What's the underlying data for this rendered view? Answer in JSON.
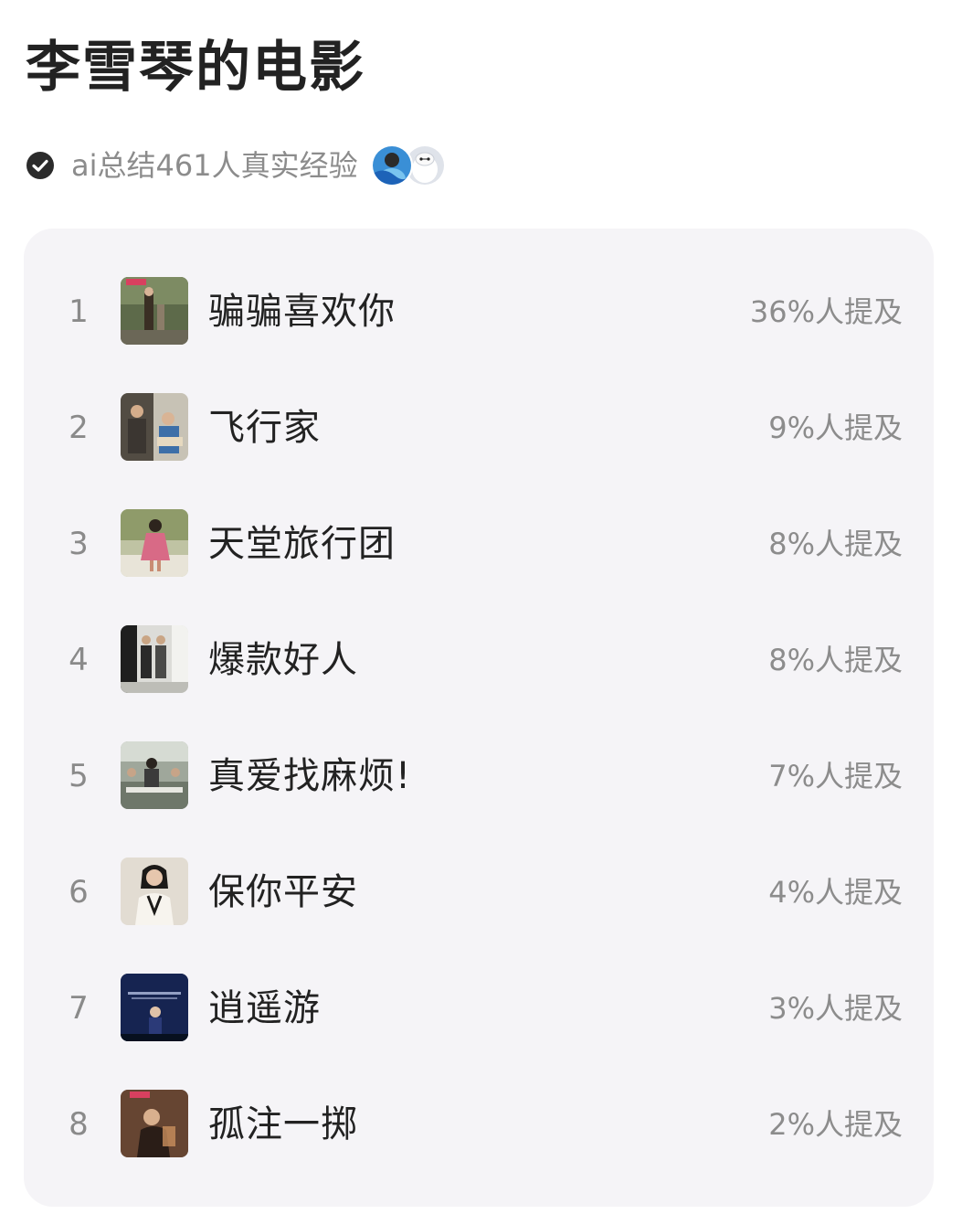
{
  "page": {
    "title": "李雪琴的电影",
    "summary_text": "ai总结461人真实经验"
  },
  "icons": {
    "verified": "check-circle-icon"
  },
  "colors": {
    "card_background": "#f5f4f7",
    "secondary_text": "#8c8c8c",
    "primary_text": "#222222"
  },
  "movies": [
    {
      "rank": "1",
      "title": "骗骗喜欢你",
      "mention": "36%人提及",
      "mention_pct": 36
    },
    {
      "rank": "2",
      "title": "飞行家",
      "mention": "9%人提及",
      "mention_pct": 9
    },
    {
      "rank": "3",
      "title": "天堂旅行团",
      "mention": "8%人提及",
      "mention_pct": 8
    },
    {
      "rank": "4",
      "title": "爆款好人",
      "mention": "8%人提及",
      "mention_pct": 8
    },
    {
      "rank": "5",
      "title": "真爱找麻烦!",
      "mention": "7%人提及",
      "mention_pct": 7
    },
    {
      "rank": "6",
      "title": "保你平安",
      "mention": "4%人提及",
      "mention_pct": 4
    },
    {
      "rank": "7",
      "title": "逍遥游",
      "mention": "3%人提及",
      "mention_pct": 3
    },
    {
      "rank": "8",
      "title": "孤注一掷",
      "mention": "2%人提及",
      "mention_pct": 2
    }
  ]
}
